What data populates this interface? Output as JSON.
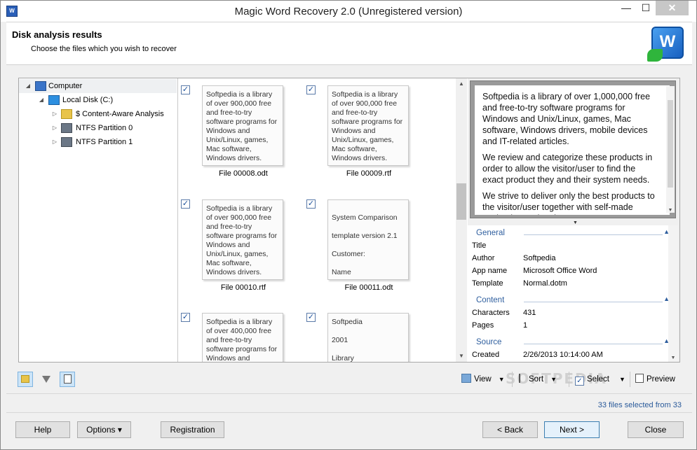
{
  "window": {
    "title": "Magic Word Recovery 2.0 (Unregistered version)",
    "app_icon_text": "W"
  },
  "header": {
    "title": "Disk analysis results",
    "subtitle": "Choose the files which you wish to recover",
    "logo_text": "W"
  },
  "tree": {
    "items": [
      {
        "label": "Computer",
        "icon": "computer-icon",
        "expander": "◢"
      },
      {
        "label": "Local Disk (C:)",
        "icon": "disk-icon",
        "expander": "◢"
      },
      {
        "label": "$ Content-Aware Analysis",
        "icon": "folder-icon",
        "expander": "▷"
      },
      {
        "label": "NTFS Partition 0",
        "icon": "partition-icon",
        "expander": "▷"
      },
      {
        "label": "NTFS Partition 1",
        "icon": "partition-icon",
        "expander": "▷"
      }
    ]
  },
  "files": [
    {
      "name": "File 00008.odt",
      "checked": true,
      "lines": [
        "Softpedia is a library of over 900,000 free and free-to-try software programs for Windows and Unix/Linux, games, Mac software, Windows drivers."
      ]
    },
    {
      "name": "File 00009.rtf",
      "checked": true,
      "lines": [
        "Softpedia is a library of over 900,000 free and free-to-try software programs for Windows and Unix/Linux, games, Mac software, Windows drivers."
      ]
    },
    {
      "name": "File 00010.rtf",
      "checked": true,
      "lines": [
        "Softpedia is a library of over 900,000 free and free-to-try software programs for Windows and Unix/Linux, games, Mac software, Windows drivers."
      ]
    },
    {
      "name": "File 00011.odt",
      "checked": true,
      "lines": [
        "System Comparison",
        "template version 2.1",
        "Customer:",
        "Name"
      ]
    },
    {
      "name": "",
      "checked": true,
      "lines": [
        "Softpedia is a library of over 400,000 free and free-to-try software programs for Windows and"
      ]
    },
    {
      "name": "",
      "checked": true,
      "lines": [
        "Softpedia",
        "2001",
        "Library"
      ]
    }
  ],
  "preview": {
    "paragraphs": [
      "Softpedia is a library of over 1,000,000 free and free-to-try software programs for Windows and Unix/Linux, games, Mac software, Windows drivers, mobile devices and IT-related articles.",
      "We review and categorize these products in order to allow the visitor/user to find the exact product they and their system needs.",
      "We strive to deliver only the best products to the visitor/user together with self-made evaluation and review notes."
    ]
  },
  "properties": {
    "sections": [
      {
        "title": "General",
        "rows": [
          {
            "key": "Title",
            "value": ""
          },
          {
            "key": "Author",
            "value": "Softpedia"
          },
          {
            "key": "App name",
            "value": "Microsoft Office Word"
          },
          {
            "key": "Template",
            "value": "Normal.dotm"
          }
        ]
      },
      {
        "title": "Content",
        "rows": [
          {
            "key": "Characters",
            "value": "431"
          },
          {
            "key": "Pages",
            "value": "1"
          }
        ]
      },
      {
        "title": "Source",
        "rows": [
          {
            "key": "Created",
            "value": "2/26/2013 10:14:00 AM"
          }
        ]
      }
    ]
  },
  "toolbar": {
    "view": "View",
    "sort": "Sort",
    "select": "Select",
    "preview": "Preview",
    "watermark": "SOFTPEDIA"
  },
  "status": {
    "selection": "33 files selected from 33"
  },
  "buttons": {
    "help": "Help",
    "options": "Options ▾",
    "registration": "Registration",
    "back": "< Back",
    "next": "Next >",
    "close": "Close"
  },
  "glyphs": {
    "check": "✓",
    "minimize": "—",
    "maximize": "☐",
    "close": "✕",
    "chevron_up": "▲",
    "chevron_down": "▼",
    "dropdown": "▼"
  }
}
